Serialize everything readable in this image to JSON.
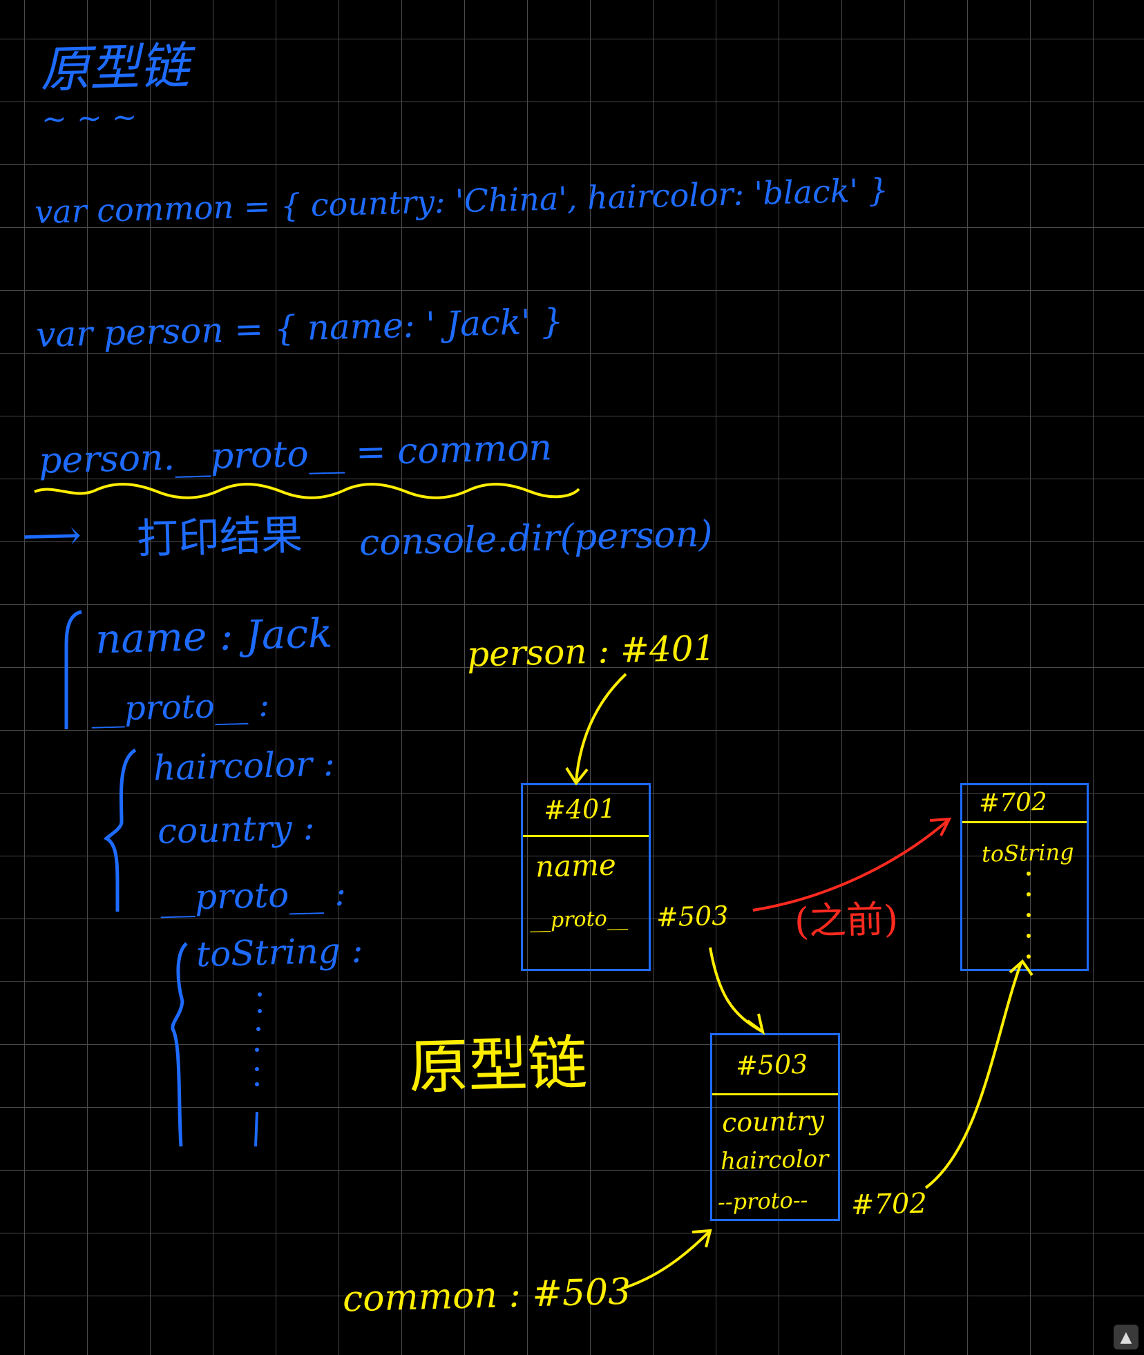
{
  "title": "原型链",
  "title_marks": "~ ~ ~",
  "lines": {
    "common_decl": "var common = { country: 'China', haircolor: 'black' }",
    "person_decl": "var person = { name: ' Jack' }",
    "assign": "person.__proto__ = common",
    "print_arrow": "⟶",
    "print_label": "打印结果",
    "print_call": "console.dir(person)"
  },
  "dir_output": {
    "name_line": "name : Jack",
    "proto_line": "__proto__ :",
    "haircolor_line": "haircolor :",
    "country_line": "country :",
    "inner_proto_line": "__proto__ :",
    "tostring_line": "toString :"
  },
  "diagram": {
    "person_ref": "person : #401",
    "common_ref": "common : #503",
    "chain_label": "原型链",
    "between_label": "(之前)",
    "box401": {
      "id": "#401",
      "fields": [
        "name",
        "__proto__"
      ],
      "proto_ref": "#503"
    },
    "box503": {
      "id": "#503",
      "fields": [
        "country",
        "haircolor",
        "--proto--"
      ],
      "proto_ref": "#702"
    },
    "box702": {
      "id": "#702",
      "fields": [
        "toString"
      ]
    }
  },
  "colors": {
    "blue": "#1e6bff",
    "yellow": "#ffee00",
    "red": "#ff2a1f",
    "grid": "#4a4a4a"
  },
  "scroll_icon": "scroll-up-icon"
}
